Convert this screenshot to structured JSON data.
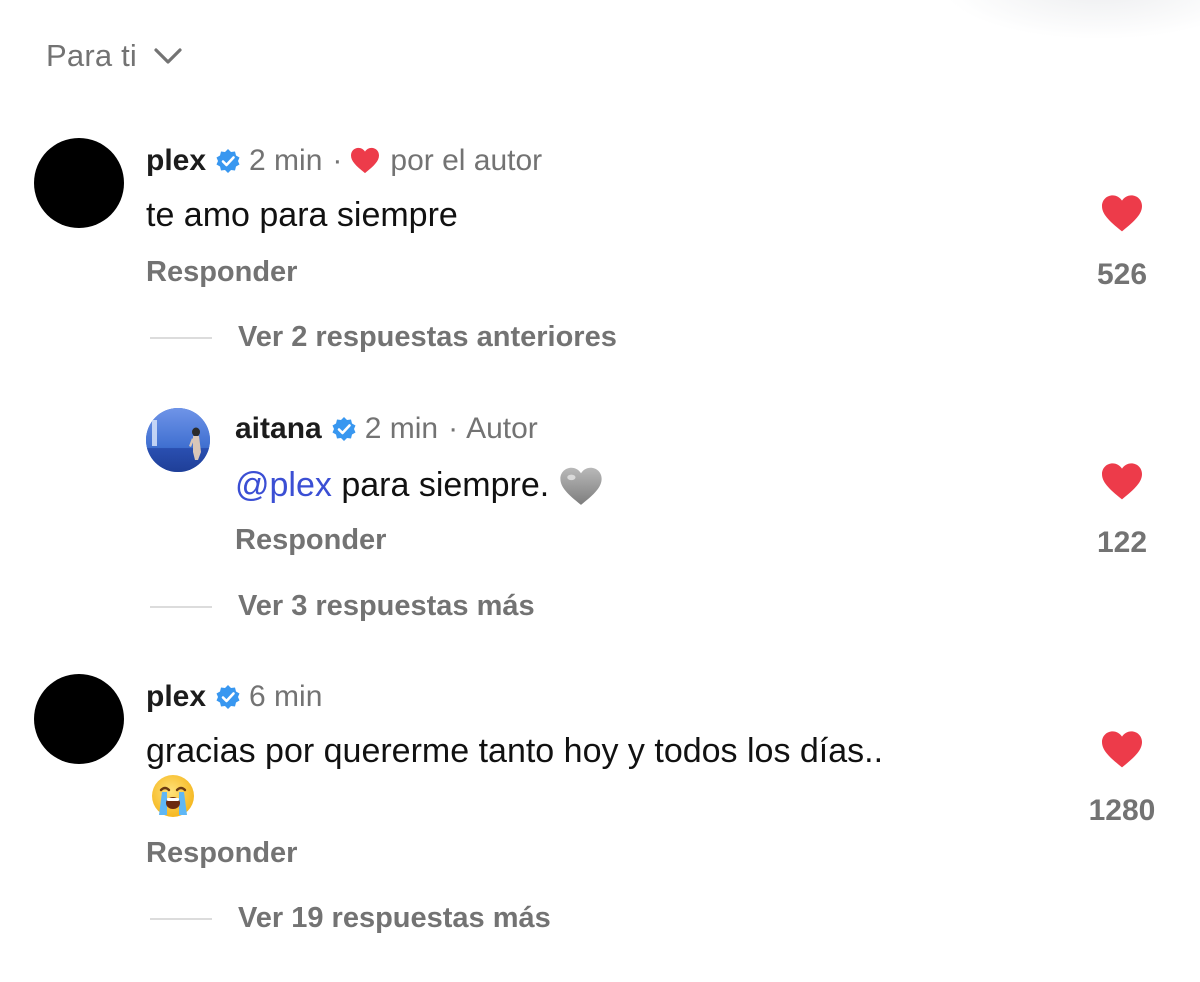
{
  "sort": {
    "label": "Para ti",
    "icon": "chevron-down-icon"
  },
  "comments": [
    {
      "username": "plex",
      "verified": true,
      "time": "2 min",
      "author_like_text": "por el autor",
      "text": "te amo para siempre",
      "reply_label": "Responder",
      "likes": "526",
      "view_more": "Ver 2 respuestas anteriores"
    },
    {
      "username": "aitana",
      "verified": true,
      "time": "2 min",
      "author_tag": "Autor",
      "mention": "@plex",
      "text": " para siempre.",
      "emoji": "grey-heart-emoji",
      "reply_label": "Responder",
      "likes": "122",
      "view_more": "Ver 3 respuestas más"
    },
    {
      "username": "plex",
      "verified": true,
      "time": "6 min",
      "text": "gracias por quererme tanto hoy y todos los días..",
      "emoji": "loudly-crying-face-emoji",
      "reply_label": "Responder",
      "likes": "1280",
      "view_more": "Ver 19 respuestas más"
    }
  ],
  "colors": {
    "muted_text": "#737373",
    "verified_blue": "#3897f0",
    "heart_red": "#ed3b4a",
    "mention_blue": "#3b4fd4"
  }
}
